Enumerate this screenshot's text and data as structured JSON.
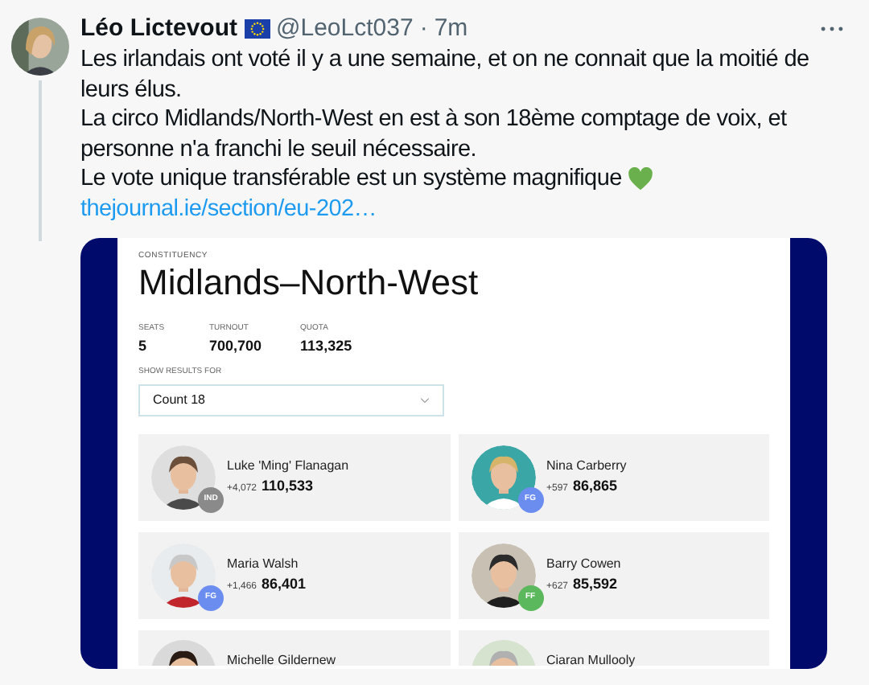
{
  "tweet": {
    "author": "Léo Lictevout",
    "handle": "@LeoLct037",
    "separator": "·",
    "time": "7m",
    "paragraphs": [
      "Les irlandais ont voté il y a une semaine, et on ne connait que la moitié de leurs élus.",
      "La circo Midlands/North-West en est à son 18ème comptage de voix, et personne n'a franchi le seuil nécessaire.",
      "Le vote unique transférable est un système magnifique"
    ],
    "link": "thejournal.ie/section/eu-202…"
  },
  "results": {
    "eyebrow": "CONSTITUENCY",
    "title": "Midlands–North-West",
    "stats": [
      {
        "label": "SEATS",
        "value": "5"
      },
      {
        "label": "TURNOUT",
        "value": "700,700"
      },
      {
        "label": "QUOTA",
        "value": "113,325"
      }
    ],
    "select_label": "SHOW RESULTS FOR",
    "select_value": "Count 18",
    "candidates": [
      {
        "name": "Luke 'Ming' Flanagan",
        "change": "+4,072",
        "votes": "110,533",
        "party": "IND",
        "color": "#8a8a8a"
      },
      {
        "name": "Nina Carberry",
        "change": "+597",
        "votes": "86,865",
        "party": "FG",
        "color": "#6b8df0"
      },
      {
        "name": "Maria Walsh",
        "change": "+1,466",
        "votes": "86,401",
        "party": "FG",
        "color": "#6b8df0"
      },
      {
        "name": "Barry Cowen",
        "change": "+627",
        "votes": "85,592",
        "party": "FF",
        "color": "#5cb85c"
      },
      {
        "name": "Michelle Gildernew"
      },
      {
        "name": "Ciaran Mullooly"
      }
    ]
  }
}
